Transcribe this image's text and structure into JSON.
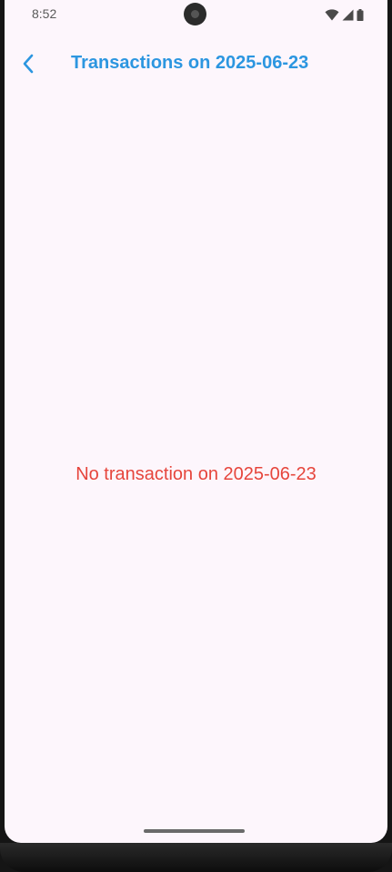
{
  "status_bar": {
    "time": "8:52",
    "icons": [
      "wifi-icon",
      "cell-signal-icon",
      "battery-icon"
    ]
  },
  "app_bar": {
    "back_icon": "chevron-left-icon",
    "title": "Transactions on 2025-06-23"
  },
  "content": {
    "empty_message": "No transaction on 2025-06-23"
  },
  "colors": {
    "title": "#2c96e0",
    "empty_message": "#e6453c",
    "background": "#fdf6fc"
  }
}
